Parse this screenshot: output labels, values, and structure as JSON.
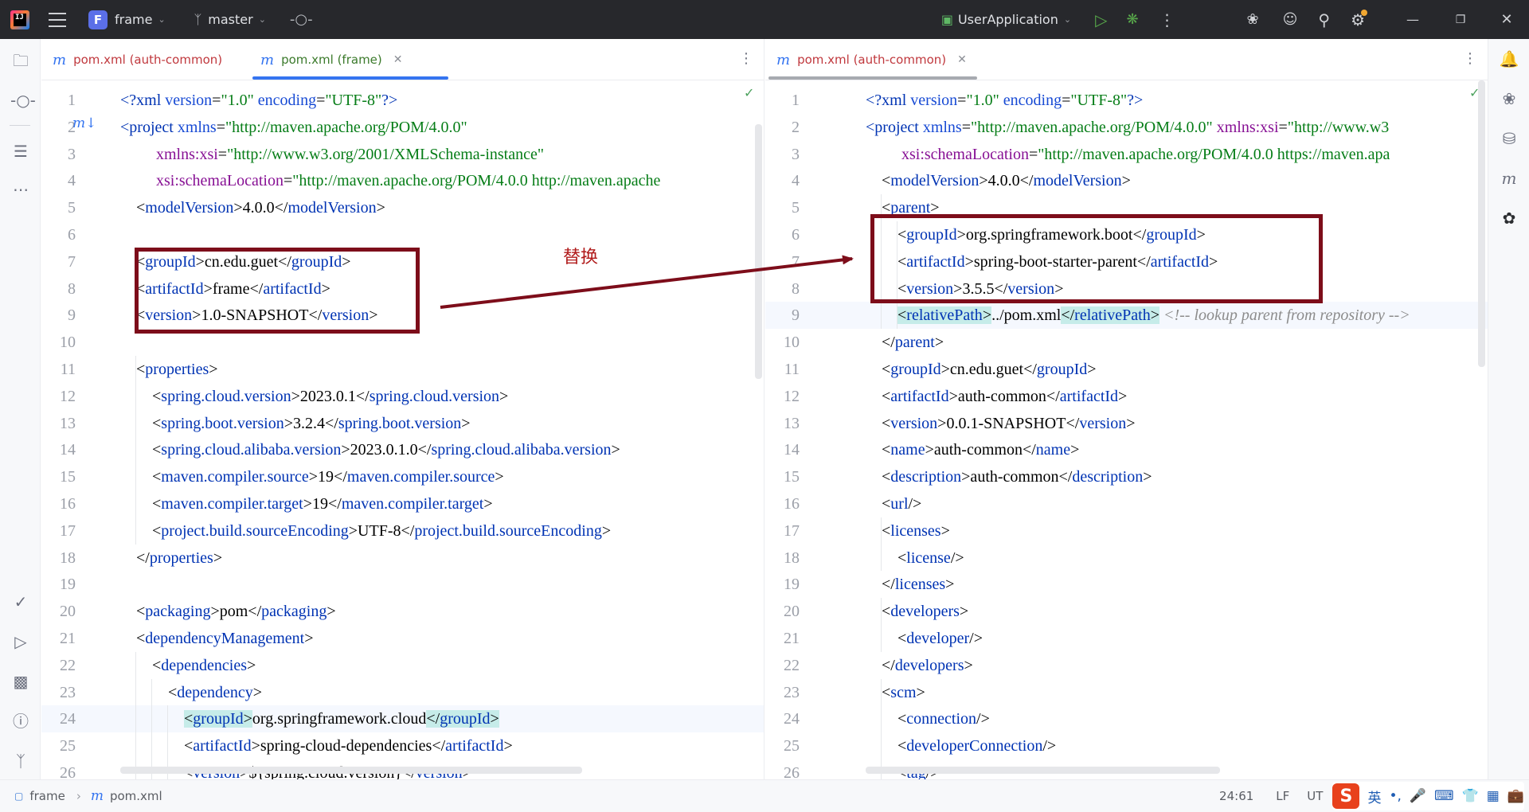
{
  "titlebar": {
    "project_badge": "F",
    "project_name": "frame",
    "branch": "master",
    "run_config": "UserApplication"
  },
  "left_pane": {
    "tabs": [
      {
        "label": "pom.xml (auth-common)",
        "active": false
      },
      {
        "label": "pom.xml (frame)",
        "active": true,
        "closable": true
      }
    ],
    "cursor_line": 24,
    "lines": [
      {
        "n": "1",
        "html": "<span class='t'>&lt;?</span><span class='t'>xml</span> <span class='a'>version</span>=<span class='s'>\"1.0\"</span> <span class='a'>encoding</span>=<span class='s'>\"UTF-8\"</span><span class='t'>?&gt;</span>"
      },
      {
        "n": "2",
        "html": "<span class='t'>&lt;project</span> <span class='a'>xmlns</span>=<span class='s'>\"http://maven.apache.org/POM/4.0.0\"</span>"
      },
      {
        "n": "3",
        "html": "         <span class='ns'>xmlns:xsi</span>=<span class='s'>\"http://www.w3.org/2001/XMLSchema-instance\"</span>"
      },
      {
        "n": "4",
        "html": "         <span class='ns'>xsi:schemaLocation</span>=<span class='s'>\"http://maven.apache.org/POM/4.0.0 http://maven.apache</span>"
      },
      {
        "n": "5",
        "html": "    &lt;<span class='t'>modelVersion</span>&gt;4.0.0&lt;/<span class='t'>modelVersion</span>&gt;"
      },
      {
        "n": "6",
        "html": ""
      },
      {
        "n": "7",
        "html": "    &lt;<span class='t'>groupId</span>&gt;cn.edu.guet&lt;/<span class='t'>groupId</span>&gt;"
      },
      {
        "n": "8",
        "html": "    &lt;<span class='t'>artifactId</span>&gt;frame&lt;/<span class='t'>artifactId</span>&gt;"
      },
      {
        "n": "9",
        "html": "    &lt;<span class='t'>version</span>&gt;1.0-SNAPSHOT&lt;/<span class='t'>version</span>&gt;"
      },
      {
        "n": "10",
        "html": ""
      },
      {
        "n": "11",
        "html": "    &lt;<span class='t'>properties</span>&gt;"
      },
      {
        "n": "12",
        "html": "        &lt;<span class='t'>spring.cloud.version</span>&gt;2023.0.1&lt;/<span class='t'>spring.cloud.version</span>&gt;"
      },
      {
        "n": "13",
        "html": "        &lt;<span class='t'>spring.boot.version</span>&gt;3.2.4&lt;/<span class='t'>spring.boot.version</span>&gt;"
      },
      {
        "n": "14",
        "html": "        &lt;<span class='t'>spring.cloud.alibaba.version</span>&gt;2023.0.1.0&lt;/<span class='t'>spring.cloud.alibaba.version</span>&gt;"
      },
      {
        "n": "15",
        "html": "        &lt;<span class='t'>maven.compiler.source</span>&gt;19&lt;/<span class='t'>maven.compiler.source</span>&gt;"
      },
      {
        "n": "16",
        "html": "        &lt;<span class='t'>maven.compiler.target</span>&gt;19&lt;/<span class='t'>maven.compiler.target</span>&gt;"
      },
      {
        "n": "17",
        "html": "        &lt;<span class='t'>project.build.sourceEncoding</span>&gt;UTF-8&lt;/<span class='t'>project.build.sourceEncoding</span>&gt;"
      },
      {
        "n": "18",
        "html": "    &lt;/<span class='t'>properties</span>&gt;"
      },
      {
        "n": "19",
        "html": ""
      },
      {
        "n": "20",
        "html": "    &lt;<span class='t'>packaging</span>&gt;pom&lt;/<span class='t'>packaging</span>&gt;"
      },
      {
        "n": "21",
        "html": "    &lt;<span class='t'>dependencyManagement</span>&gt;"
      },
      {
        "n": "22",
        "html": "        &lt;<span class='t'>dependencies</span>&gt;"
      },
      {
        "n": "23",
        "html": "            &lt;<span class='t'>dependency</span>&gt;"
      },
      {
        "n": "24",
        "html": "                <span class='hl'>&lt;<span class='t'>groupId</span>&gt;</span>org.springframework.cloud<span class='hl'>&lt;/<span class='t'>groupId</span>&gt;</span>"
      },
      {
        "n": "25",
        "html": "                &lt;<span class='t'>artifactId</span>&gt;spring-cloud-dependencies&lt;/<span class='t'>artifactId</span>&gt;"
      },
      {
        "n": "26",
        "html": "                &lt;<span class='t'>version</span>&gt;${spring.cloud.version}&lt;/<span class='t'>version</span>&gt;"
      }
    ]
  },
  "right_pane": {
    "tabs": [
      {
        "label": "pom.xml (auth-common)",
        "active": true,
        "closable": true
      }
    ],
    "cursor_line": 9,
    "lines": [
      {
        "n": "1",
        "html": "<span class='t'>&lt;?</span><span class='t'>xml</span> <span class='a'>version</span>=<span class='s'>\"1.0\"</span> <span class='a'>encoding</span>=<span class='s'>\"UTF-8\"</span><span class='t'>?&gt;</span>"
      },
      {
        "n": "2",
        "html": "<span class='t'>&lt;project</span> <span class='a'>xmlns</span>=<span class='s'>\"http://maven.apache.org/POM/4.0.0\"</span> <span class='ns'>xmlns:xsi</span>=<span class='s'>\"http://www.w3</span>"
      },
      {
        "n": "3",
        "html": "         <span class='ns'>xsi:schemaLocation</span>=<span class='s'>\"http://maven.apache.org/POM/4.0.0 https://maven.apa</span>"
      },
      {
        "n": "4",
        "html": "    &lt;<span class='t'>modelVersion</span>&gt;4.0.0&lt;/<span class='t'>modelVersion</span>&gt;"
      },
      {
        "n": "5",
        "html": "    &lt;<span class='t'>parent</span>&gt;"
      },
      {
        "n": "6",
        "html": "        &lt;<span class='t'>groupId</span>&gt;org.springframework.boot&lt;/<span class='t'>groupId</span>&gt;"
      },
      {
        "n": "7",
        "html": "        &lt;<span class='t'>artifactId</span>&gt;spring-boot-starter-parent&lt;/<span class='t'>artifactId</span>&gt;"
      },
      {
        "n": "8",
        "html": "        &lt;<span class='t'>version</span>&gt;3.5.5&lt;/<span class='t'>version</span>&gt;"
      },
      {
        "n": "9",
        "html": "        <span class='hl'>&lt;<span class='t'>relativePath</span>&gt;</span>../pom.xml<span class='hl'>&lt;/<span class='t'>relativePath</span>&gt;</span> <span class='c'>&lt;!-- lookup parent from repository --&gt;</span>"
      },
      {
        "n": "10",
        "html": "    &lt;/<span class='t'>parent</span>&gt;"
      },
      {
        "n": "11",
        "html": "    &lt;<span class='t'>groupId</span>&gt;cn.edu.guet&lt;/<span class='t'>groupId</span>&gt;"
      },
      {
        "n": "12",
        "html": "    &lt;<span class='t'>artifactId</span>&gt;auth-common&lt;/<span class='t'>artifactId</span>&gt;"
      },
      {
        "n": "13",
        "html": "    &lt;<span class='t'>version</span>&gt;0.0.1-SNAPSHOT&lt;/<span class='t'>version</span>&gt;"
      },
      {
        "n": "14",
        "html": "    &lt;<span class='t'>name</span>&gt;auth-common&lt;/<span class='t'>name</span>&gt;"
      },
      {
        "n": "15",
        "html": "    &lt;<span class='t'>description</span>&gt;auth-common&lt;/<span class='t'>description</span>&gt;"
      },
      {
        "n": "16",
        "html": "    &lt;<span class='t'>url</span>/&gt;"
      },
      {
        "n": "17",
        "html": "    &lt;<span class='t'>licenses</span>&gt;"
      },
      {
        "n": "18",
        "html": "        &lt;<span class='t'>license</span>/&gt;"
      },
      {
        "n": "19",
        "html": "    &lt;/<span class='t'>licenses</span>&gt;"
      },
      {
        "n": "20",
        "html": "    &lt;<span class='t'>developers</span>&gt;"
      },
      {
        "n": "21",
        "html": "        &lt;<span class='t'>developer</span>/&gt;"
      },
      {
        "n": "22",
        "html": "    &lt;/<span class='t'>developers</span>&gt;"
      },
      {
        "n": "23",
        "html": "    &lt;<span class='t'>scm</span>&gt;"
      },
      {
        "n": "24",
        "html": "        &lt;<span class='t'>connection</span>/&gt;"
      },
      {
        "n": "25",
        "html": "        &lt;<span class='t'>developerConnection</span>/&gt;"
      },
      {
        "n": "26",
        "html": "        &lt;<span class='t'>tag</span>/&gt;"
      }
    ]
  },
  "annotation": {
    "label": "替换",
    "color": "#7d0d1a"
  },
  "statusbar": {
    "project": "frame",
    "file": "pom.xml",
    "position": "24:61",
    "line_separator": "LF",
    "encoding": "UT",
    "ime_logo": "S",
    "ime_lang": "英"
  },
  "icons": {
    "left_strip": [
      "folder-icon",
      "commit-icon",
      "structure-icon",
      "more-tools-icon",
      "build-icon",
      "services-icon",
      "terminal-icon",
      "problems-icon",
      "git-icon"
    ],
    "right_strip": [
      "notifications-icon",
      "ai-assistant-icon",
      "database-icon",
      "maven-icon",
      "plugin-icon"
    ]
  },
  "colors": {
    "titlebar_bg": "#27282c",
    "tag": "#0033b3",
    "attribute": "#174ad4",
    "string": "#067d17",
    "namespace": "#871094",
    "comment": "#8c8c8c",
    "match_highlight": "#c6ece9",
    "active_tab_underline": "#3574f0"
  }
}
